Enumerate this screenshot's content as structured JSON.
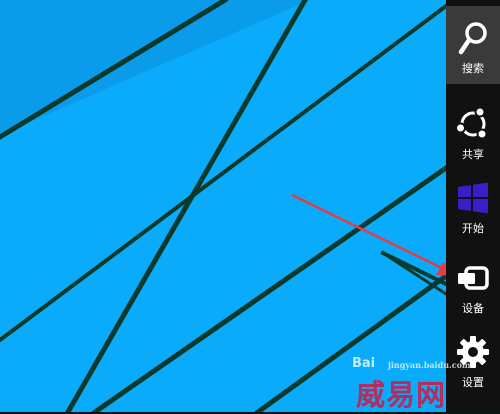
{
  "desktop": {
    "background_color": "#0aabfa",
    "stripe_color": "#0b3a2c"
  },
  "charms": [
    {
      "label": "搜索",
      "icon": "search-icon",
      "active": true
    },
    {
      "label": "共享",
      "icon": "share-icon",
      "active": false
    },
    {
      "label": "开始",
      "icon": "windows-logo-icon",
      "active": false
    },
    {
      "label": "设备",
      "icon": "devices-icon",
      "active": false
    },
    {
      "label": "设置",
      "icon": "gear-icon",
      "active": false
    }
  ],
  "annotation": {
    "arrow_color": "#e63c46"
  },
  "watermark": {
    "brand": "Bai",
    "site": "jingyan.baidu.com",
    "text": "威易网"
  }
}
